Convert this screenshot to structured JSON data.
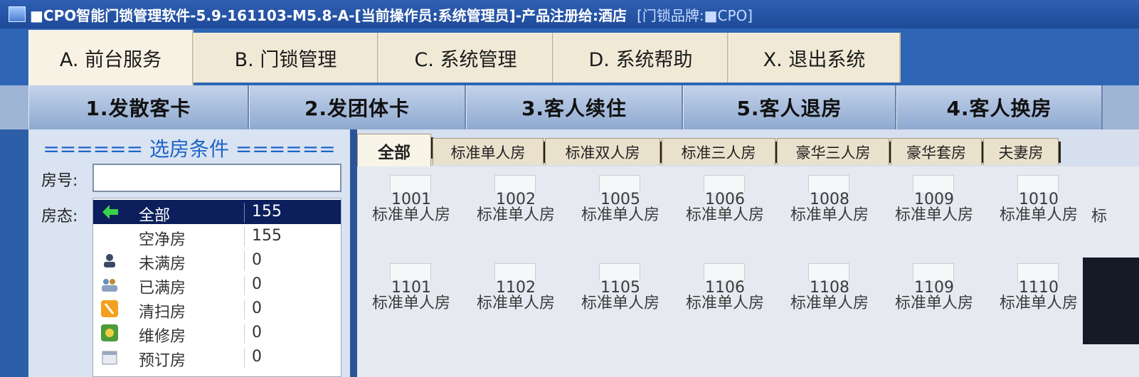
{
  "window": {
    "title": "■CPO智能门锁管理软件-5.9-161103-M5.8-A-[当前操作员:系统管理员]-产品注册给:酒店",
    "brand": "[门锁品牌:■CPO]"
  },
  "menu": [
    {
      "label": "A. 前台服务",
      "active": true
    },
    {
      "label": "B. 门锁管理"
    },
    {
      "label": "C. 系统管理"
    },
    {
      "label": "D. 系统帮助"
    },
    {
      "label": "X. 退出系统"
    }
  ],
  "toolbar": [
    {
      "label": "1.发散客卡"
    },
    {
      "label": "2.发团体卡"
    },
    {
      "label": "3.客人续住"
    },
    {
      "label": "5.客人退房"
    },
    {
      "label": "4.客人换房"
    }
  ],
  "filter": {
    "title": "====== 选房条件 ======",
    "room_label": "房号:",
    "room_value": "",
    "status_label": "房态:",
    "statuses": [
      {
        "name": "全部",
        "count": "155",
        "icon": "arrow-icon",
        "selected": true
      },
      {
        "name": "空净房",
        "count": "155",
        "icon": "blank-icon"
      },
      {
        "name": "未满房",
        "count": "0",
        "icon": "person-icon"
      },
      {
        "name": "已满房",
        "count": "0",
        "icon": "people-icon"
      },
      {
        "name": "清扫房",
        "count": "0",
        "icon": "broom-icon"
      },
      {
        "name": "维修房",
        "count": "0",
        "icon": "wrench-icon"
      },
      {
        "name": "预订房",
        "count": "0",
        "icon": "calendar-icon"
      }
    ]
  },
  "room_tabs": [
    {
      "label": "全部",
      "active": true
    },
    {
      "label": "标准单人房"
    },
    {
      "label": "标准双人房"
    },
    {
      "label": "标准三人房"
    },
    {
      "label": "豪华三人房"
    },
    {
      "label": "豪华套房"
    },
    {
      "label": "夫妻房"
    }
  ],
  "rooms": [
    {
      "number": "1001",
      "type": "标准单人房"
    },
    {
      "number": "1002",
      "type": "标准单人房"
    },
    {
      "number": "1005",
      "type": "标准单人房"
    },
    {
      "number": "1006",
      "type": "标准单人房"
    },
    {
      "number": "1008",
      "type": "标准单人房"
    },
    {
      "number": "1009",
      "type": "标准单人房"
    },
    {
      "number": "1010",
      "type": "标准单人房"
    },
    {
      "number": "1101",
      "type": "标准单人房"
    },
    {
      "number": "1102",
      "type": "标准单人房"
    },
    {
      "number": "1105",
      "type": "标准单人房"
    },
    {
      "number": "1106",
      "type": "标准单人房"
    },
    {
      "number": "1108",
      "type": "标准单人房"
    },
    {
      "number": "1109",
      "type": "标准单人房"
    },
    {
      "number": "1110",
      "type": "标准单人房"
    }
  ],
  "edge_glyph": "标",
  "colors": {
    "title_bar": "#1e4a99",
    "selected_row": "#0c1f5c",
    "section_title": "#1e64c8"
  }
}
